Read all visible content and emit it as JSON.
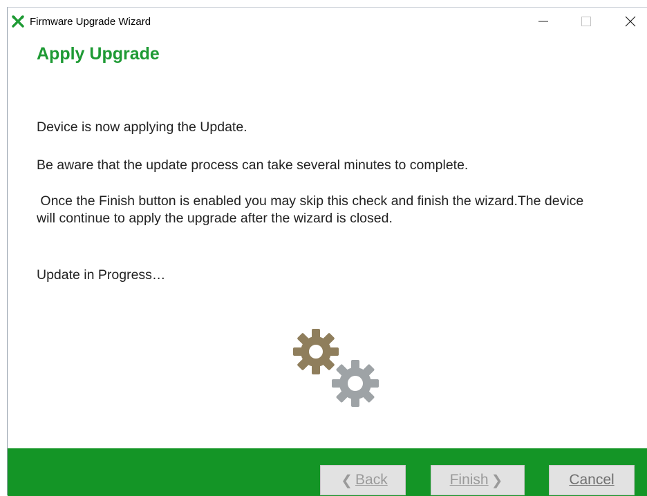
{
  "window": {
    "title": "Firmware Upgrade Wizard",
    "icon": "wrench-cross-icon",
    "controls": [
      "minimize-icon",
      "maximize-icon",
      "close-icon"
    ]
  },
  "main": {
    "heading": "Apply Upgrade",
    "paragraph1": "Device is now applying the Update.",
    "paragraph2": "Be aware that the update process can take several minutes to complete.",
    "paragraph3": " Once the Finish button is enabled you may skip this check and finish the wizard.The device will continue to apply the upgrade after the wizard is closed.",
    "progress_text": "Update in Progress…",
    "progress_icon": "gears-icon"
  },
  "footer": {
    "back_label": "Back",
    "finish_label": "Finish",
    "cancel_label": "Cancel"
  },
  "colors": {
    "accent_green": "#1e9a34",
    "footer_green": "#149526",
    "gear_brown": "#8f7e5c",
    "gear_gray": "#9ea3a6"
  }
}
